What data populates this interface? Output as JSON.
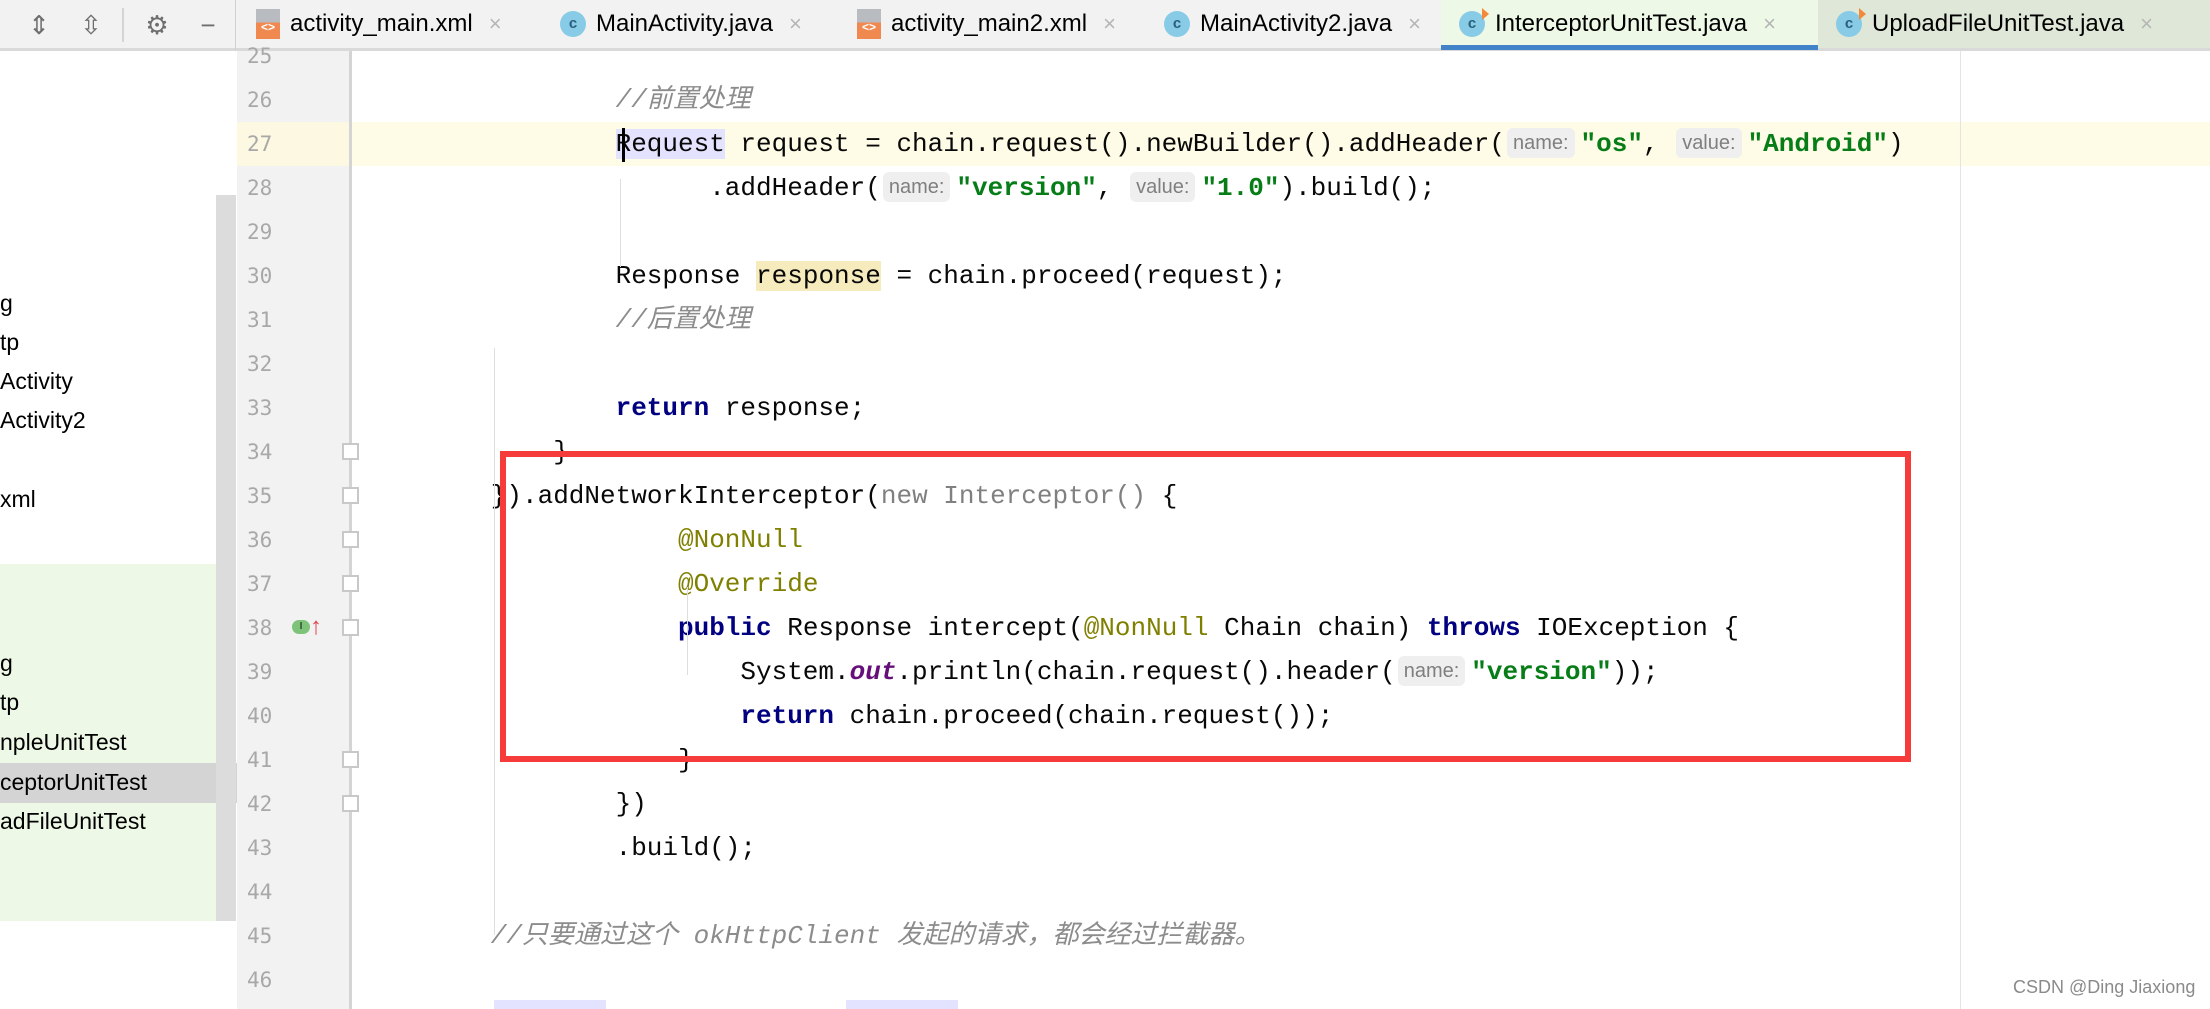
{
  "toolbar": {
    "icons": [
      "expand-all-icon",
      "collapse-all-icon",
      "gear-icon",
      "minimize-icon"
    ]
  },
  "tabs": [
    {
      "label": "activity_main.xml",
      "icon": "xml-file-icon",
      "close": "×"
    },
    {
      "label": "MainActivity.java",
      "icon": "java-class-icon",
      "close": "×"
    },
    {
      "label": "activity_main2.xml",
      "icon": "xml-file-icon",
      "close": "×"
    },
    {
      "label": "MainActivity2.java",
      "icon": "java-class-icon",
      "close": "×"
    },
    {
      "label": "InterceptorUnitTest.java",
      "icon": "test-class-icon",
      "close": "×",
      "active": true
    },
    {
      "label": "UploadFileUnitTest.java",
      "icon": "test-class-icon",
      "close": "×"
    }
  ],
  "class_icon_letter": "c",
  "project_tree": {
    "items": [
      "g",
      "tp",
      "Activity",
      "Activity2",
      "xml",
      "g",
      "tp",
      "npleUnitTest",
      "ceptorUnitTest",
      "adFileUnitTest"
    ],
    "selected": "ceptorUnitTest"
  },
  "editor": {
    "current_line": 27,
    "line_numbers": [
      "25",
      "26",
      "27",
      "28",
      "29",
      "30",
      "31",
      "32",
      "33",
      "34",
      "35",
      "36",
      "37",
      "38",
      "39",
      "40",
      "41",
      "42",
      "43",
      "44",
      "45",
      "46"
    ],
    "lines": [
      {
        "n": 25,
        "indent": 0,
        "tokens": []
      },
      {
        "n": 26,
        "indent": 16,
        "tokens": [
          {
            "t": "//前置处理",
            "c": "cm"
          }
        ]
      },
      {
        "n": 27,
        "indent": 16,
        "tokens": [
          {
            "t": "Request",
            "c": "hl-type"
          },
          {
            "t": " request = chain.request().newBuilder().addHeader("
          },
          {
            "h": "name:"
          },
          {
            "t": "\"os\"",
            "c": "str"
          },
          {
            "t": ", "
          },
          {
            "h": "value:"
          },
          {
            "t": "\"Android\"",
            "c": "str"
          },
          {
            "t": ")"
          }
        ]
      },
      {
        "n": 28,
        "indent": 22,
        "tokens": [
          {
            "t": ".addHeader("
          },
          {
            "h": "name:"
          },
          {
            "t": "\"version\"",
            "c": "str"
          },
          {
            "t": ", "
          },
          {
            "h": "value:"
          },
          {
            "t": "\"1.0\"",
            "c": "str"
          },
          {
            "t": ").build();"
          }
        ]
      },
      {
        "n": 29,
        "indent": 16,
        "tokens": []
      },
      {
        "n": 30,
        "indent": 16,
        "tokens": [
          {
            "t": "Response "
          },
          {
            "t": "response",
            "c": "hl-var"
          },
          {
            "t": " = chain.proceed(request);"
          }
        ]
      },
      {
        "n": 31,
        "indent": 16,
        "tokens": [
          {
            "t": "//后置处理",
            "c": "cm"
          }
        ]
      },
      {
        "n": 32,
        "indent": 16,
        "tokens": []
      },
      {
        "n": 33,
        "indent": 16,
        "tokens": [
          {
            "t": "return",
            "c": "kw"
          },
          {
            "t": " response;"
          }
        ]
      },
      {
        "n": 34,
        "indent": 12,
        "tokens": [
          {
            "t": "}"
          }
        ]
      },
      {
        "n": 35,
        "indent": 8,
        "tokens": [
          {
            "t": "}).addNetworkInterceptor("
          },
          {
            "t": "new Interceptor()",
            "c": "dim"
          },
          {
            "t": " {"
          }
        ]
      },
      {
        "n": 36,
        "indent": 20,
        "tokens": [
          {
            "t": "@NonNull",
            "c": "ann"
          }
        ]
      },
      {
        "n": 37,
        "indent": 20,
        "tokens": [
          {
            "t": "@Override",
            "c": "ann"
          }
        ]
      },
      {
        "n": 38,
        "indent": 20,
        "tokens": [
          {
            "t": "public",
            "c": "kw"
          },
          {
            "t": " Response intercept("
          },
          {
            "t": "@NonNull",
            "c": "ann"
          },
          {
            "t": " Chain chain) "
          },
          {
            "t": "throws",
            "c": "kw"
          },
          {
            "t": " IOException {"
          }
        ]
      },
      {
        "n": 39,
        "indent": 24,
        "tokens": [
          {
            "t": "System."
          },
          {
            "t": "out",
            "c": "fld"
          },
          {
            "t": ".println(chain.request().header("
          },
          {
            "h": "name:"
          },
          {
            "t": "\"version\"",
            "c": "str"
          },
          {
            "t": "));"
          }
        ]
      },
      {
        "n": 40,
        "indent": 24,
        "tokens": [
          {
            "t": "return",
            "c": "kw"
          },
          {
            "t": " chain.proceed(chain.request());"
          }
        ]
      },
      {
        "n": 41,
        "indent": 20,
        "tokens": [
          {
            "t": "}"
          }
        ]
      },
      {
        "n": 42,
        "indent": 16,
        "tokens": [
          {
            "t": "})"
          }
        ]
      },
      {
        "n": 43,
        "indent": 16,
        "tokens": [
          {
            "t": ".build();"
          }
        ]
      },
      {
        "n": 44,
        "indent": 8,
        "tokens": []
      },
      {
        "n": 45,
        "indent": 8,
        "tokens": [
          {
            "t": "//只要通过这个 okHttpClient 发起的请求，都会经过拦截器。",
            "c": "cm"
          }
        ]
      },
      {
        "n": 46,
        "indent": 8,
        "tokens": []
      }
    ],
    "gutter_markers": {
      "line": 38,
      "icons": [
        "implements-method-icon",
        "override-up-arrow-icon"
      ],
      "letter": "I"
    }
  },
  "annotation_color": "#f63b3b",
  "watermark": "CSDN @Ding Jiaxiong"
}
